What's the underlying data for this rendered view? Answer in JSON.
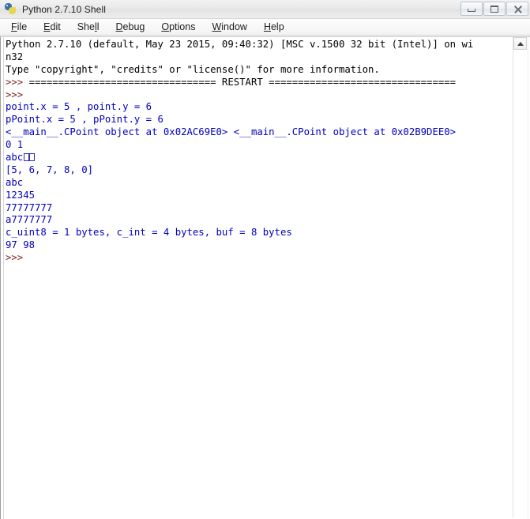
{
  "window": {
    "title": "Python 2.7.10 Shell",
    "icon": "python-logo-icon",
    "controls": {
      "minimize": "Minimize",
      "maximize": "Maximize",
      "close": "Close"
    }
  },
  "menubar": {
    "items": [
      {
        "label": "File",
        "accel_index": 0
      },
      {
        "label": "Edit",
        "accel_index": 0
      },
      {
        "label": "Shell",
        "accel_index": 3
      },
      {
        "label": "Debug",
        "accel_index": 0
      },
      {
        "label": "Options",
        "accel_index": 0
      },
      {
        "label": "Window",
        "accel_index": 0
      },
      {
        "label": "Help",
        "accel_index": 0
      }
    ]
  },
  "shell": {
    "lines": [
      {
        "text": "Python 2.7.10 (default, May 23 2015, 09:40:32) [MSC v.1500 32 bit (Intel)] on wi",
        "color": "black"
      },
      {
        "text": "n32",
        "color": "black"
      },
      {
        "text": "Type \"copyright\", \"credits\" or \"license()\" for more information.",
        "color": "black"
      },
      {
        "text": ">>> ================================ RESTART ================================",
        "color": "prompt-restart"
      },
      {
        "text": ">>> ",
        "color": "red"
      },
      {
        "text": "point.x = 5 , point.y = 6",
        "color": "blue"
      },
      {
        "text": "pPoint.x = 5 , pPoint.y = 6",
        "color": "blue"
      },
      {
        "text": "<__main__.CPoint object at 0x02AC69E0> <__main__.CPoint object at 0x02B9DEE0>",
        "color": "blue"
      },
      {
        "text": "0 1",
        "color": "blue"
      },
      {
        "text": "abc",
        "color": "blue",
        "tofu": 2
      },
      {
        "text": "[5, 6, 7, 8, 0]",
        "color": "blue"
      },
      {
        "text": "abc",
        "color": "blue"
      },
      {
        "text": "12345",
        "color": "blue"
      },
      {
        "text": "77777777",
        "color": "blue"
      },
      {
        "text": "a7777777",
        "color": "blue"
      },
      {
        "text": "c_uint8 = 1 bytes, c_int = 4 bytes, buf = 8 bytes",
        "color": "blue"
      },
      {
        "text": "97 98",
        "color": "blue"
      },
      {
        "text": ">>> ",
        "color": "red"
      }
    ],
    "prompt": ">>> ",
    "restart_banner": "================================ RESTART ================================",
    "colors": {
      "stdout_black": "#000000",
      "stdout_blue": "#0000c0",
      "prompt_red": "#7d2222",
      "background": "#ffffff"
    }
  },
  "scrollbar": {
    "up_arrow": "scroll-up-arrow"
  }
}
